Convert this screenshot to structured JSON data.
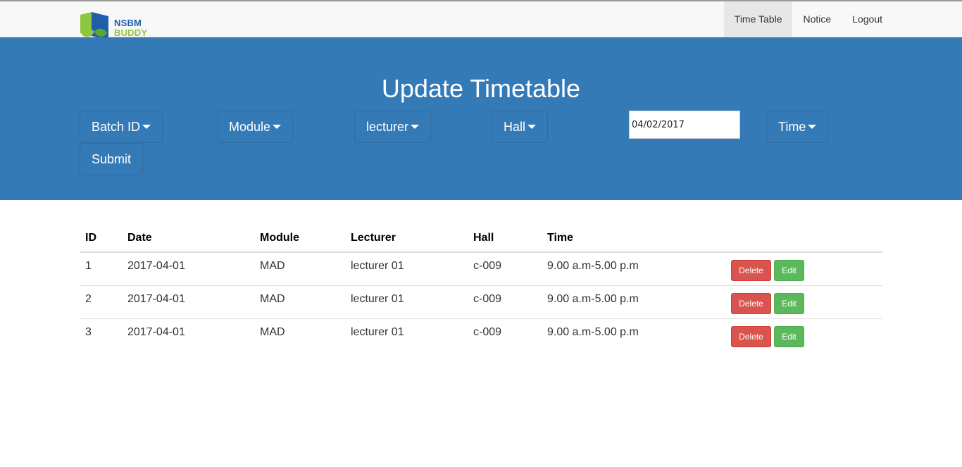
{
  "brand": {
    "line1": "NSBM",
    "line2": "BUDDY"
  },
  "nav": [
    {
      "label": "Time Table",
      "active": true
    },
    {
      "label": "Notice",
      "active": false
    },
    {
      "label": "Logout",
      "active": false
    }
  ],
  "hero": {
    "title": "Update Timetable"
  },
  "filters": {
    "batch": "Batch ID",
    "module": "Module",
    "lecturer": "lecturer",
    "hall": "Hall",
    "date_value": "04/02/2017",
    "time": "Time",
    "submit": "Submit"
  },
  "table": {
    "headers": {
      "id": "ID",
      "date": "Date",
      "module": "Module",
      "lecturer": "Lecturer",
      "hall": "Hall",
      "time": "Time"
    },
    "rows": [
      {
        "id": "1",
        "date": "2017-04-01",
        "module": "MAD",
        "lecturer": "lecturer 01",
        "hall": "c-009",
        "time": "9.00 a.m-5.00 p.m",
        "delete": "Delete",
        "edit": "Edit"
      },
      {
        "id": "2",
        "date": "2017-04-01",
        "module": "MAD",
        "lecturer": "lecturer 01",
        "hall": "c-009",
        "time": "9.00 a.m-5.00 p.m",
        "delete": "Delete",
        "edit": "Edit"
      },
      {
        "id": "3",
        "date": "2017-04-01",
        "module": "MAD",
        "lecturer": "lecturer 01",
        "hall": "c-009",
        "time": "9.00 a.m-5.00 p.m",
        "delete": "Delete",
        "edit": "Edit"
      }
    ]
  },
  "colors": {
    "primary": "#337ab7",
    "danger": "#d9534f",
    "success": "#5cb85c",
    "navbar": "#f8f8f8"
  }
}
